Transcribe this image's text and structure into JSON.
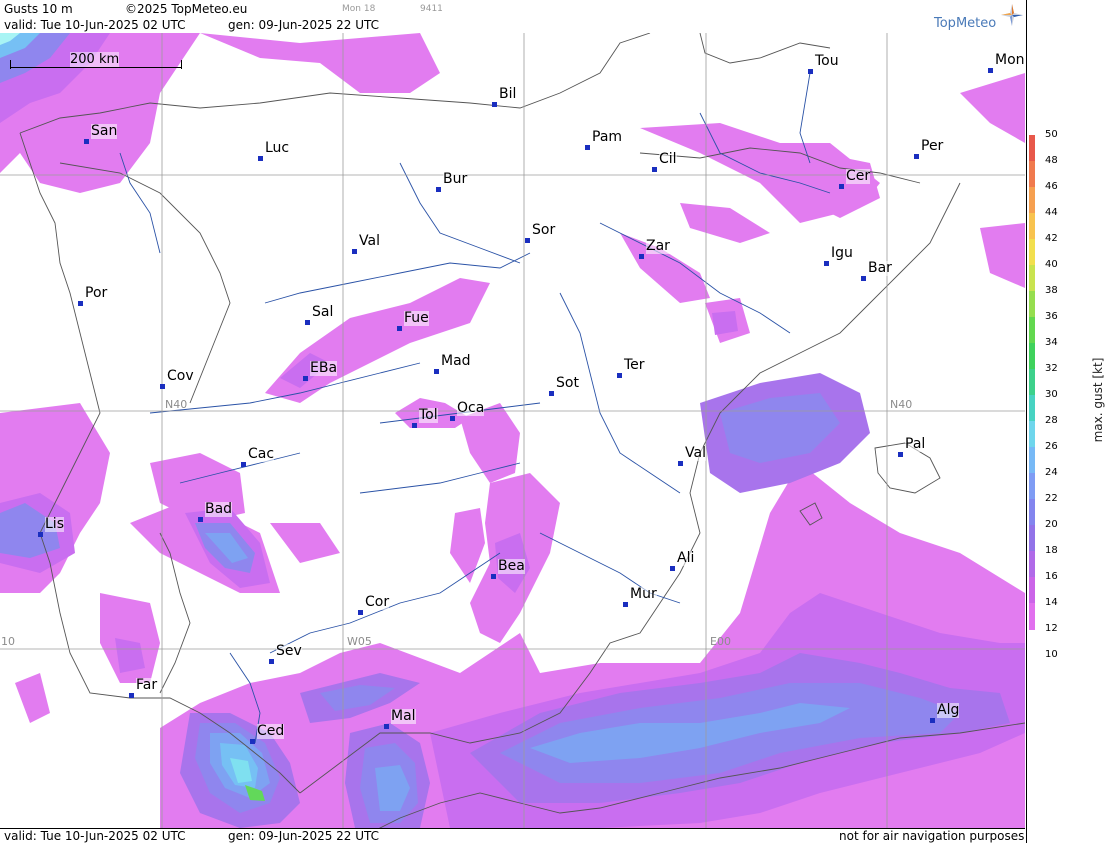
{
  "header": {
    "parameter": "Gusts 10 m",
    "copyright": "©2025 TopMeteo.eu",
    "run_code": "Mon 18",
    "id_code": "9411",
    "valid": "valid:  Tue  10-Jun-2025  02 UTC",
    "generated": "gen: 09-Jun-2025 22 UTC",
    "brand": "TopMeteo"
  },
  "scale_bar": {
    "label": "200 km"
  },
  "grid_labels": {
    "lat_40": "N40",
    "lon_w05": "W05",
    "lon_e00": "E00",
    "lon_w10": "10"
  },
  "cities": [
    {
      "code": "Tou"
    },
    {
      "code": "Mon"
    },
    {
      "code": "Bil"
    },
    {
      "code": "San"
    },
    {
      "code": "Pam"
    },
    {
      "code": "Luc"
    },
    {
      "code": "Per"
    },
    {
      "code": "Cil"
    },
    {
      "code": "Cer"
    },
    {
      "code": "Bur"
    },
    {
      "code": "Sor"
    },
    {
      "code": "Val"
    },
    {
      "code": "Zar"
    },
    {
      "code": "Igu"
    },
    {
      "code": "Bar"
    },
    {
      "code": "Por"
    },
    {
      "code": "Sal"
    },
    {
      "code": "Fue"
    },
    {
      "code": "Mad"
    },
    {
      "code": "Ter"
    },
    {
      "code": "Cov"
    },
    {
      "code": "EBa"
    },
    {
      "code": "Sot"
    },
    {
      "code": "Tol"
    },
    {
      "code": "Oca"
    },
    {
      "code": "Pal"
    },
    {
      "code": "Val"
    },
    {
      "code": "Cac"
    },
    {
      "code": "Bad"
    },
    {
      "code": "Lis"
    },
    {
      "code": "Ali"
    },
    {
      "code": "Bea"
    },
    {
      "code": "Mur"
    },
    {
      "code": "Cor"
    },
    {
      "code": "Sev"
    },
    {
      "code": "Far"
    },
    {
      "code": "Alg"
    },
    {
      "code": "Mal"
    },
    {
      "code": "Ced"
    }
  ],
  "footer": {
    "valid": "valid:  Tue  10-Jun-2025  02 UTC",
    "generated": "gen: 09-Jun-2025 22 UTC",
    "disclaimer": "not for air navigation purposes"
  },
  "legend": {
    "title": "max. gust  [kt]",
    "ticks": [
      50,
      48,
      46,
      44,
      42,
      40,
      38,
      36,
      34,
      32,
      30,
      28,
      26,
      24,
      22,
      20,
      18,
      16,
      14,
      12,
      10
    ],
    "colors": [
      "#e8584a",
      "#f07a4e",
      "#f6a050",
      "#f8c34f",
      "#f2df4e",
      "#c9e34f",
      "#96de4f",
      "#63d84f",
      "#3fd25c",
      "#3dd18b",
      "#48d3c2",
      "#6fd6ec",
      "#77b9f6",
      "#7f9cf4",
      "#8385ee",
      "#9273e8",
      "#b06ae8",
      "#cb64e8",
      "#e170ee"
    ]
  },
  "gust_colors": {
    "k12": "#e27cf0",
    "k14": "#c96ef0",
    "k16": "#a874ec",
    "k18": "#8f86ee",
    "k20": "#7ea2f2",
    "k22": "#76c0f4",
    "k24": "#7fe0f0",
    "k26": "#a8f4f4",
    "k32": "#62d85a"
  }
}
